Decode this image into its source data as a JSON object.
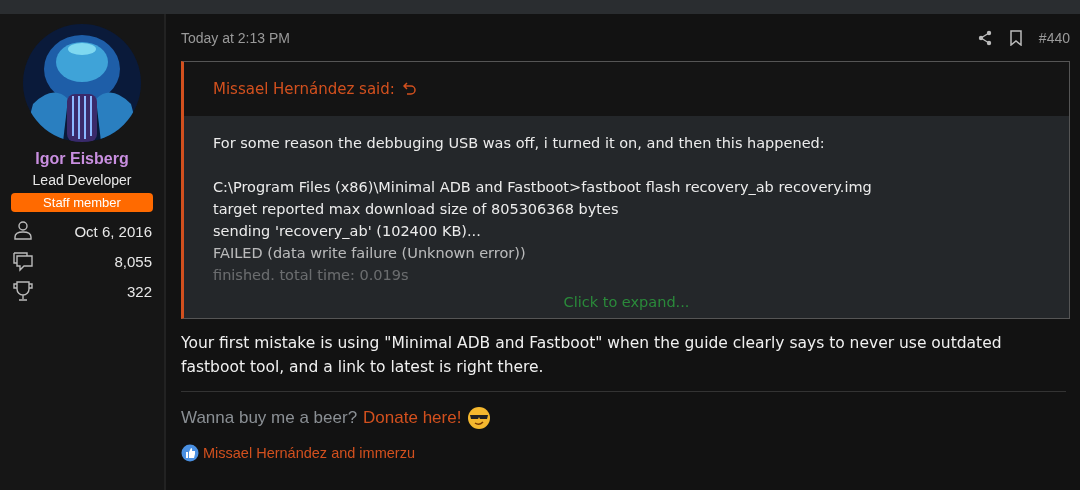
{
  "user": {
    "name": "Igor Eisberg",
    "title": "Lead Developer",
    "badge": "Staff member",
    "stats": [
      {
        "kind": "joined",
        "value": "Oct 6, 2016"
      },
      {
        "kind": "messages",
        "value": "8,055"
      },
      {
        "kind": "trophies",
        "value": "322"
      }
    ]
  },
  "post": {
    "time": "Today at 2:13 PM",
    "number": "#440",
    "quote": {
      "author": "Missael Hernández said:",
      "intro": "For some reason the debbuging USB was off, i turned it on, and then this happened:",
      "log_lines": [
        "C:\\Program Files (x86)\\Minimal ADB and Fastboot>fastboot flash recovery_ab recovery.img",
        "target reported max download size of 805306368 bytes",
        "sending 'recovery_ab' (102400 KB)...",
        "FAILED (data write failure (Unknown error))",
        "finished. total time: 0.019s"
      ],
      "expand": "Click to expand..."
    },
    "body": "Your first mistake is using \"Minimal ADB and Fastboot\" when the guide clearly says to never use outdated fastboot tool, and a link to latest is right there.",
    "signature": {
      "text": "Wanna buy me a beer?",
      "link": "Donate here!"
    },
    "reactions": "Missael Hernández and immerzu"
  }
}
